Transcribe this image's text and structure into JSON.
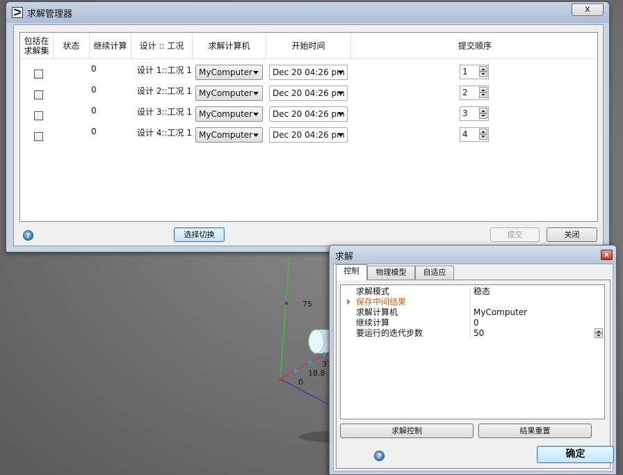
{
  "viewport": {
    "labels": [
      "75",
      "18.8",
      "37",
      "0"
    ]
  },
  "solve_manager": {
    "title": "求解管理器",
    "close_label": "x",
    "columns": [
      "包括在求解集",
      "状态",
      "继续计算",
      "设计 :: 工况",
      "求解计算机",
      "开始时间",
      "提交顺序"
    ],
    "rows": [
      {
        "included": false,
        "status": "",
        "continue": "0",
        "design_case": "设计 1::工况 1",
        "computer": "MyComputer",
        "start_time": "Dec 20 04:26 pm",
        "order": "1"
      },
      {
        "included": false,
        "status": "",
        "continue": "0",
        "design_case": "设计 2::工况 1",
        "computer": "MyComputer",
        "start_time": "Dec 20 04:26 pm",
        "order": "2"
      },
      {
        "included": false,
        "status": "",
        "continue": "0",
        "design_case": "设计 3::工况 1",
        "computer": "MyComputer",
        "start_time": "Dec 20 04:26 pm",
        "order": "3"
      },
      {
        "included": false,
        "status": "",
        "continue": "0",
        "design_case": "设计 4::工况 1",
        "computer": "MyComputer",
        "start_time": "Dec 20 04:26 pm",
        "order": "4"
      }
    ],
    "buttons": {
      "toggle_selection": "选择切换",
      "submit": "提交",
      "close": "关闭"
    },
    "help_glyph": "?"
  },
  "solve_dialog": {
    "title": "求解",
    "close_glyph": "x",
    "tabs": [
      "控制",
      "物理模型",
      "自适应"
    ],
    "active_tab": "控制",
    "properties": [
      {
        "name": "求解模式",
        "value": "稳态"
      },
      {
        "name": "保存中间结果",
        "value": "",
        "group": true
      },
      {
        "name": "求解计算机",
        "value": "MyComputer"
      },
      {
        "name": "继续计算",
        "value": "0"
      },
      {
        "name": "要运行的迭代步数",
        "value": "50"
      }
    ],
    "buttons": {
      "solve_control": "求解控制",
      "result_reset": "结果重置",
      "ok": "确定"
    },
    "help_glyph": "?"
  },
  "colors": {
    "axis_green": "#3cc23c",
    "axis_red": "#d93232",
    "axis_blue": "#3a3ab0",
    "group_orange": "#c0651a",
    "focus_blue": "#3c7fb1"
  }
}
